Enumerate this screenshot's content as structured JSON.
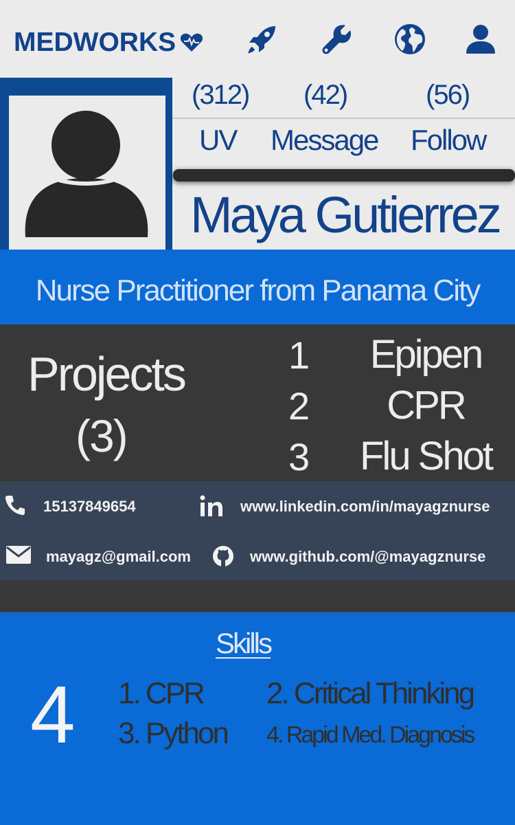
{
  "header": {
    "brand": "MEDWORKS",
    "icons": [
      "heart-icon",
      "rocket-icon",
      "wrench-icon",
      "globe-icon",
      "user-icon"
    ]
  },
  "profile": {
    "name": "Maya Gutierrez",
    "subtitle": "Nurse Practitioner from Panama City",
    "stats": [
      {
        "count": "(312)",
        "label": "UV"
      },
      {
        "count": "(42)",
        "label": "Message"
      },
      {
        "count": "(56)",
        "label": "Follow"
      }
    ]
  },
  "projects": {
    "title": "Projects",
    "count": "(3)",
    "items": [
      {
        "num": "1",
        "name": "Epipen"
      },
      {
        "num": "2",
        "name": "CPR"
      },
      {
        "num": "3",
        "name": "Flu Shot"
      }
    ]
  },
  "contact": {
    "phone": "15137849654",
    "linkedin": "www.linkedin.com/in/mayagznurse",
    "email": "mayagz@gmail.com",
    "github": "www.github.com/@mayagznurse"
  },
  "skills": {
    "title": "Skills",
    "count": "4",
    "items": [
      "1. CPR",
      "2. Critical Thinking",
      "3. Python",
      "4. Rapid Med. Diagnosis"
    ]
  },
  "colors": {
    "brand_blue": "#12428a",
    "accent_blue": "#0a6ad6",
    "dark_panel": "#383838",
    "contact_panel": "#374458"
  }
}
